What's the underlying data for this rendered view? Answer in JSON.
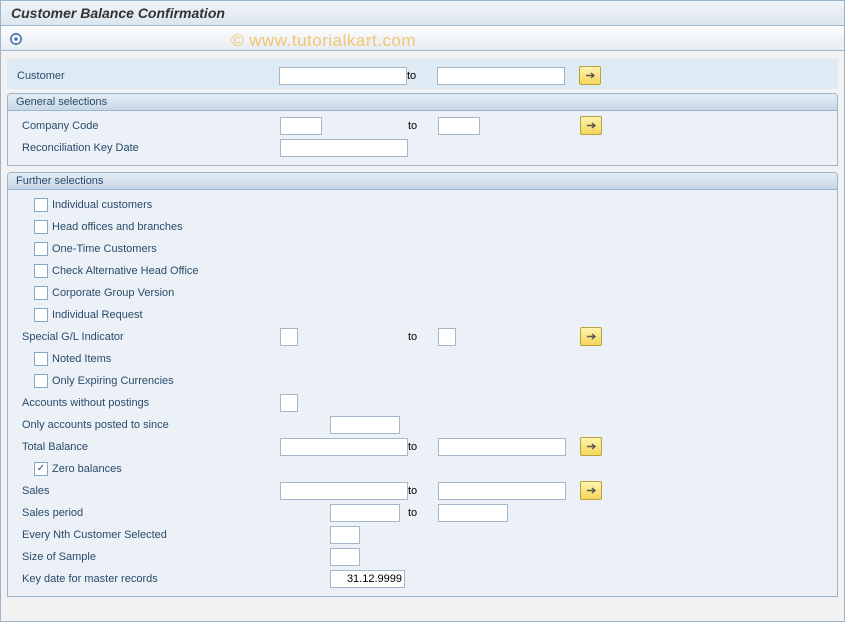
{
  "title": "Customer Balance Confirmation",
  "watermark": "© www.tutorialkart.com",
  "toolbar": {
    "execute_icon": "execute"
  },
  "top": {
    "customer_label": "Customer",
    "customer_from": "",
    "to_label": "to",
    "customer_to": ""
  },
  "general": {
    "title": "General selections",
    "company_code_label": "Company Code",
    "company_code_from": "",
    "to_label": "to",
    "company_code_to": "",
    "recon_date_label": "Reconciliation Key Date",
    "recon_date": ""
  },
  "further": {
    "title": "Further selections",
    "chk_individual_customers": {
      "checked": false,
      "label": "Individual customers"
    },
    "chk_head_offices": {
      "checked": false,
      "label": "Head offices and branches"
    },
    "chk_one_time": {
      "checked": false,
      "label": "One-Time Customers"
    },
    "chk_alt_head_office": {
      "checked": false,
      "label": "Check Alternative Head Office"
    },
    "chk_corp_group": {
      "checked": false,
      "label": "Corporate Group Version"
    },
    "chk_individual_request": {
      "checked": false,
      "label": "Individual Request"
    },
    "special_gl_label": "Special G/L Indicator",
    "special_gl_from": "",
    "to_label": "to",
    "special_gl_to": "",
    "chk_noted_items": {
      "checked": false,
      "label": "Noted Items"
    },
    "chk_expiring_curr": {
      "checked": false,
      "label": "Only Expiring Currencies"
    },
    "accounts_no_postings_label": "Accounts without postings",
    "accounts_no_postings": "",
    "only_posted_since_label": "Only accounts posted to since",
    "only_posted_since": "",
    "total_balance_label": "Total Balance",
    "total_balance_from": "",
    "total_balance_to": "",
    "chk_zero_balances": {
      "checked": true,
      "label": "Zero balances"
    },
    "sales_label": "Sales",
    "sales_from": "",
    "sales_to": "",
    "sales_period_label": "Sales period",
    "sales_period_from": "",
    "sales_period_to": "",
    "every_nth_label": "Every Nth Customer Selected",
    "every_nth": "",
    "size_of_sample_label": "Size of Sample",
    "size_of_sample": "",
    "key_date_master_label": "Key date for master records",
    "key_date_master": "31.12.9999"
  }
}
